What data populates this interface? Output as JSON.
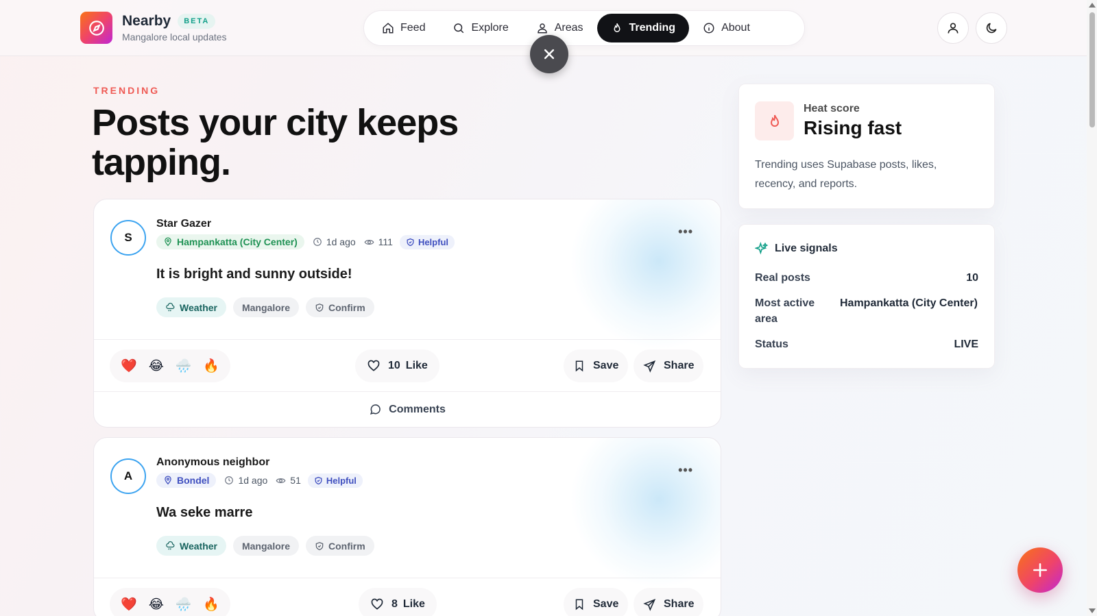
{
  "brand": {
    "name": "Nearby",
    "badge": "BETA",
    "subtitle": "Mangalore local updates"
  },
  "nav": [
    {
      "label": "Feed",
      "icon": "home-icon"
    },
    {
      "label": "Explore",
      "icon": "search-icon"
    },
    {
      "label": "Areas",
      "icon": "user-pin-icon"
    },
    {
      "label": "Trending",
      "icon": "flame-icon",
      "active": true
    },
    {
      "label": "About",
      "icon": "info-icon"
    }
  ],
  "hero": {
    "eyebrow": "TRENDING",
    "title": "Posts your city keeps tapping."
  },
  "posts": [
    {
      "avatar": "S",
      "author": "Star Gazer",
      "location": "Hampankatta (City Center)",
      "location_color": "#1f9254",
      "location_bg": "#eaf6ee",
      "time": "1d ago",
      "views": "111",
      "badge": "Helpful",
      "text": "It is bright and sunny outside!",
      "tags": [
        "Weather",
        "Mangalore",
        "Confirm"
      ],
      "likes": "10",
      "like_label": "Like",
      "save_label": "Save",
      "share_label": "Share",
      "comments_label": "Comments"
    },
    {
      "avatar": "A",
      "author": "Anonymous neighbor",
      "location": "Bondel",
      "location_color": "#3f4fbf",
      "location_bg": "#eef1fb",
      "time": "1d ago",
      "views": "51",
      "badge": "Helpful",
      "text": "Wa seke marre",
      "tags": [
        "Weather",
        "Mangalore",
        "Confirm"
      ],
      "likes": "8",
      "like_label": "Like",
      "save_label": "Save",
      "share_label": "Share"
    }
  ],
  "reactions": [
    "❤️",
    "😂",
    "🌧️",
    "🔥"
  ],
  "heat": {
    "label": "Heat score",
    "value": "Rising fast",
    "description": "Trending uses Supabase posts, likes, recency, and reports."
  },
  "signals": {
    "title": "Live signals",
    "rows": [
      {
        "k": "Real posts",
        "v": "10"
      },
      {
        "k": "Most active area",
        "v": "Hampankatta (City Center)"
      },
      {
        "k": "Status",
        "v": "LIVE"
      }
    ]
  },
  "colors": {
    "accent": "#ef5a54",
    "active_nav": "#111216",
    "avatar_ring": "#3ba3f0"
  }
}
